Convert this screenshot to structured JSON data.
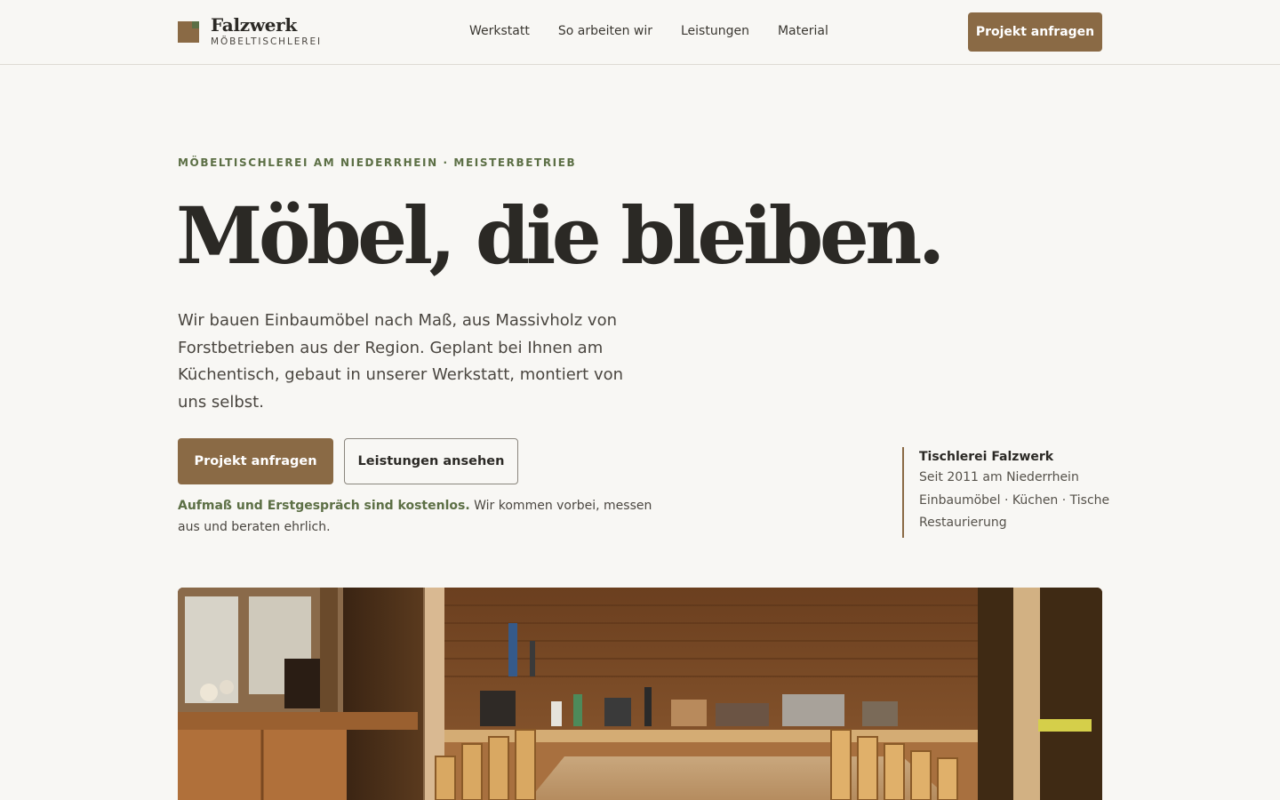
{
  "header": {
    "brand_name": "Falzwerk",
    "brand_sub": "MÖBELTISCHLEREI",
    "nav": [
      "Werkstatt",
      "So arbeiten wir",
      "Leistungen",
      "Material"
    ],
    "cta": "Projekt anfragen"
  },
  "hero": {
    "eyebrow": "MÖBELTISCHLEREI AM NIEDERRHEIN · MEISTERBETRIEB",
    "headline": "Möbel, die bleiben.",
    "lead": "Wir bauen Einbaumöbel nach Maß, aus Massivholz von Forstbetrieben aus der Region. Geplant bei Ihnen am Küchentisch, gebaut in unserer Werkstatt, montiert von uns selbst.",
    "primary_button": "Projekt anfragen",
    "secondary_button": "Leistungen ansehen",
    "note_strong": "Aufmaß und Erstgespräch sind kostenlos.",
    "note_rest": " Wir kommen vorbei, messen aus und beraten ehrlich."
  },
  "info_card": {
    "title": "Tischlerei Falzwerk",
    "lines": [
      "Seit 2011 am Niederrhein",
      "Einbaumöbel · Küchen · Tische",
      "Restaurierung"
    ]
  },
  "colors": {
    "background": "#f8f7f4",
    "accent_brown": "#8a6a45",
    "accent_green": "#5c6f45",
    "text": "#2b2925"
  },
  "icons": {
    "logo": "falzwerk-logo-square-icon"
  }
}
